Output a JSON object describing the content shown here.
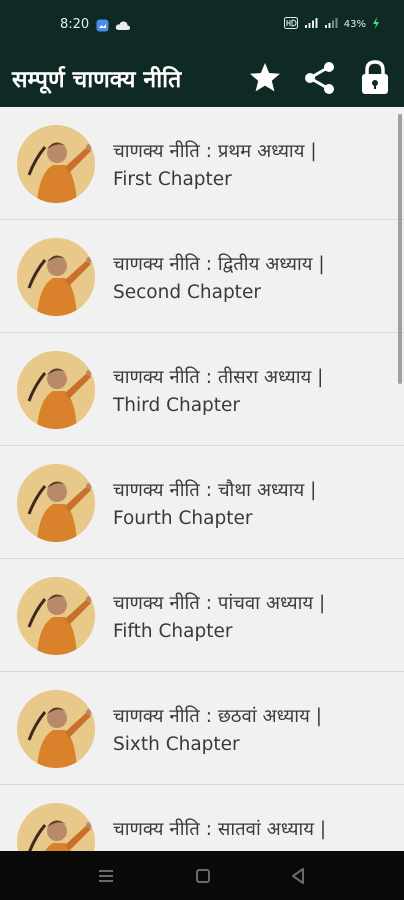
{
  "status": {
    "time": "8:20",
    "battery": "43%"
  },
  "appbar": {
    "title": "सम्पूर्ण चाणक्य नीति",
    "icons": [
      "star-icon",
      "share-icon",
      "lock-icon"
    ]
  },
  "chapters": [
    {
      "hindi": "चाणक्य नीति : प्रथम अध्याय |",
      "english": "First Chapter"
    },
    {
      "hindi": "चाणक्य नीति : द्वितीय अध्याय |",
      "english": "Second Chapter"
    },
    {
      "hindi": "चाणक्य नीति : तीसरा अध्याय |",
      "english": "Third Chapter"
    },
    {
      "hindi": "चाणक्य नीति : चौथा अध्याय |",
      "english": "Fourth Chapter"
    },
    {
      "hindi": "चाणक्य नीति : पांचवा अध्याय |",
      "english": "Fifth Chapter"
    },
    {
      "hindi": "चाणक्य नीति : छठवां अध्याय |",
      "english": "Sixth Chapter"
    },
    {
      "hindi": "चाणक्य नीति : सातवां अध्याय |",
      "english": ""
    }
  ],
  "colors": {
    "appbar": "#0f2a24",
    "list_bg": "#f2f1f2",
    "text": "#3a3a3a",
    "avatar_bg": "#e8c98a",
    "robe": "#d9822b"
  }
}
